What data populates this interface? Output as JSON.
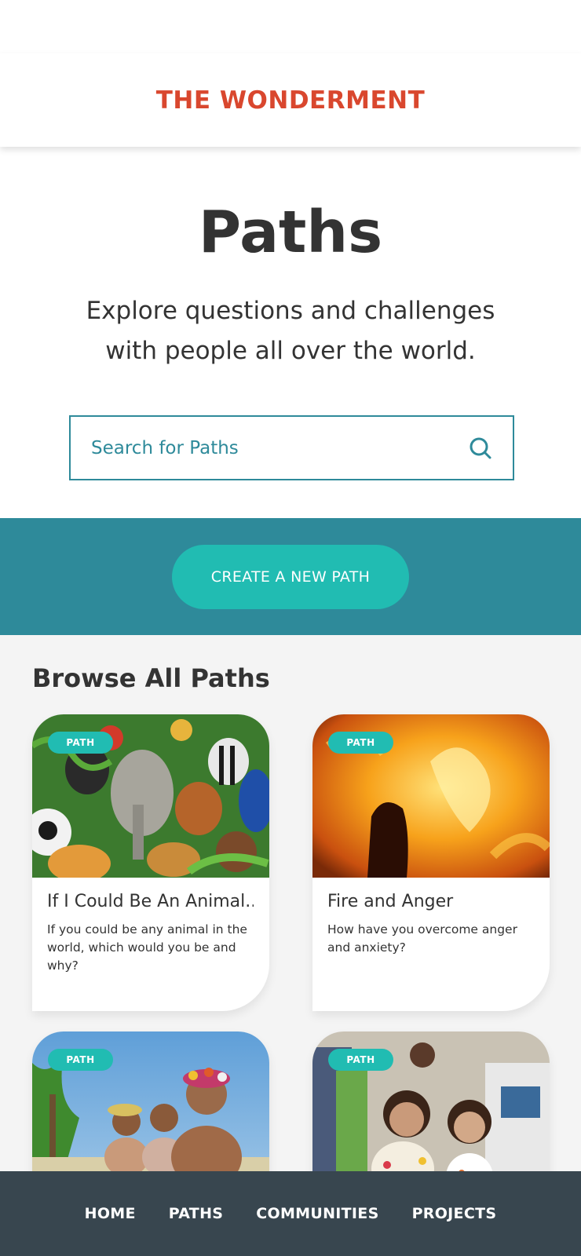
{
  "header": {
    "brand": "THE WONDERMENT"
  },
  "hero": {
    "title": "Paths",
    "subtitle": "Explore questions and challenges with people all over the world.",
    "search_placeholder": "Search for Paths"
  },
  "cta": {
    "label": "CREATE A NEW PATH"
  },
  "browse": {
    "title": "Browse All Paths",
    "cards": [
      {
        "badge": "PATH",
        "title": "If I Could Be An Animal...",
        "description": "If you could be any animal in the world, which would you be and why?",
        "image": "animals collage"
      },
      {
        "badge": "PATH",
        "title": "Fire and Anger",
        "description": "How have you overcome anger and anxiety?",
        "image": "fire flames"
      },
      {
        "badge": "PATH",
        "title": "",
        "description": "",
        "image": "women with flower crowns on beach"
      },
      {
        "badge": "PATH",
        "title": "",
        "description": "",
        "image": "smiling children"
      }
    ]
  },
  "nav": {
    "items": [
      "HOME",
      "PATHS",
      "COMMUNITIES",
      "PROJECTS"
    ]
  },
  "colors": {
    "brand": "#d9472e",
    "teal_dark": "#2e8a9a",
    "teal_light": "#21bcb2",
    "nav_bg": "#38464f"
  }
}
